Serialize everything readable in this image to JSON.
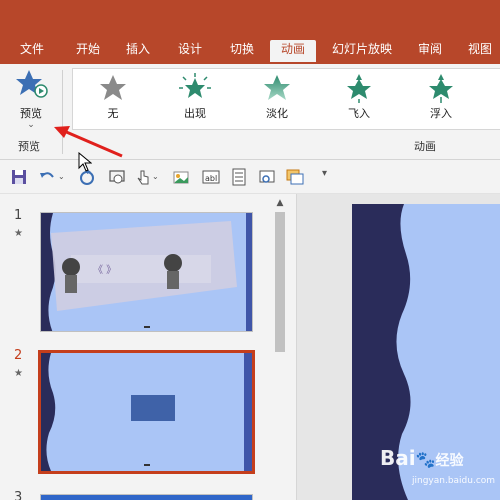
{
  "ribbon_tabs": [
    {
      "label": "文件"
    },
    {
      "label": "开始"
    },
    {
      "label": "插入"
    },
    {
      "label": "设计"
    },
    {
      "label": "切换"
    },
    {
      "label": "动画"
    },
    {
      "label": "幻灯片放映"
    },
    {
      "label": "审阅"
    },
    {
      "label": "视图"
    }
  ],
  "active_tab": "动画",
  "preview": {
    "label": "预览",
    "group_label": "预览"
  },
  "animation_group": {
    "label": "动画",
    "effects": [
      {
        "label": "无",
        "icon": "star-gray-icon"
      },
      {
        "label": "出现",
        "icon": "star-burst-icon"
      },
      {
        "label": "淡化",
        "icon": "star-fade-icon"
      },
      {
        "label": "飞入",
        "icon": "star-fly-in-icon"
      },
      {
        "label": "浮入",
        "icon": "star-float-in-icon"
      }
    ]
  },
  "slides": [
    {
      "number": "1",
      "selected": false
    },
    {
      "number": "2",
      "selected": true
    },
    {
      "number": "3",
      "selected": false
    }
  ],
  "watermark": {
    "text": "Bai",
    "text2": "经验",
    "url": "jingyan.baidu.com"
  },
  "colors": {
    "accent": "#b7472a",
    "selection": "#c43e1c",
    "slide_bg": "#aac5f6",
    "slide_wave": "#2a2c5a",
    "effect_green": "#2e8b6e"
  }
}
